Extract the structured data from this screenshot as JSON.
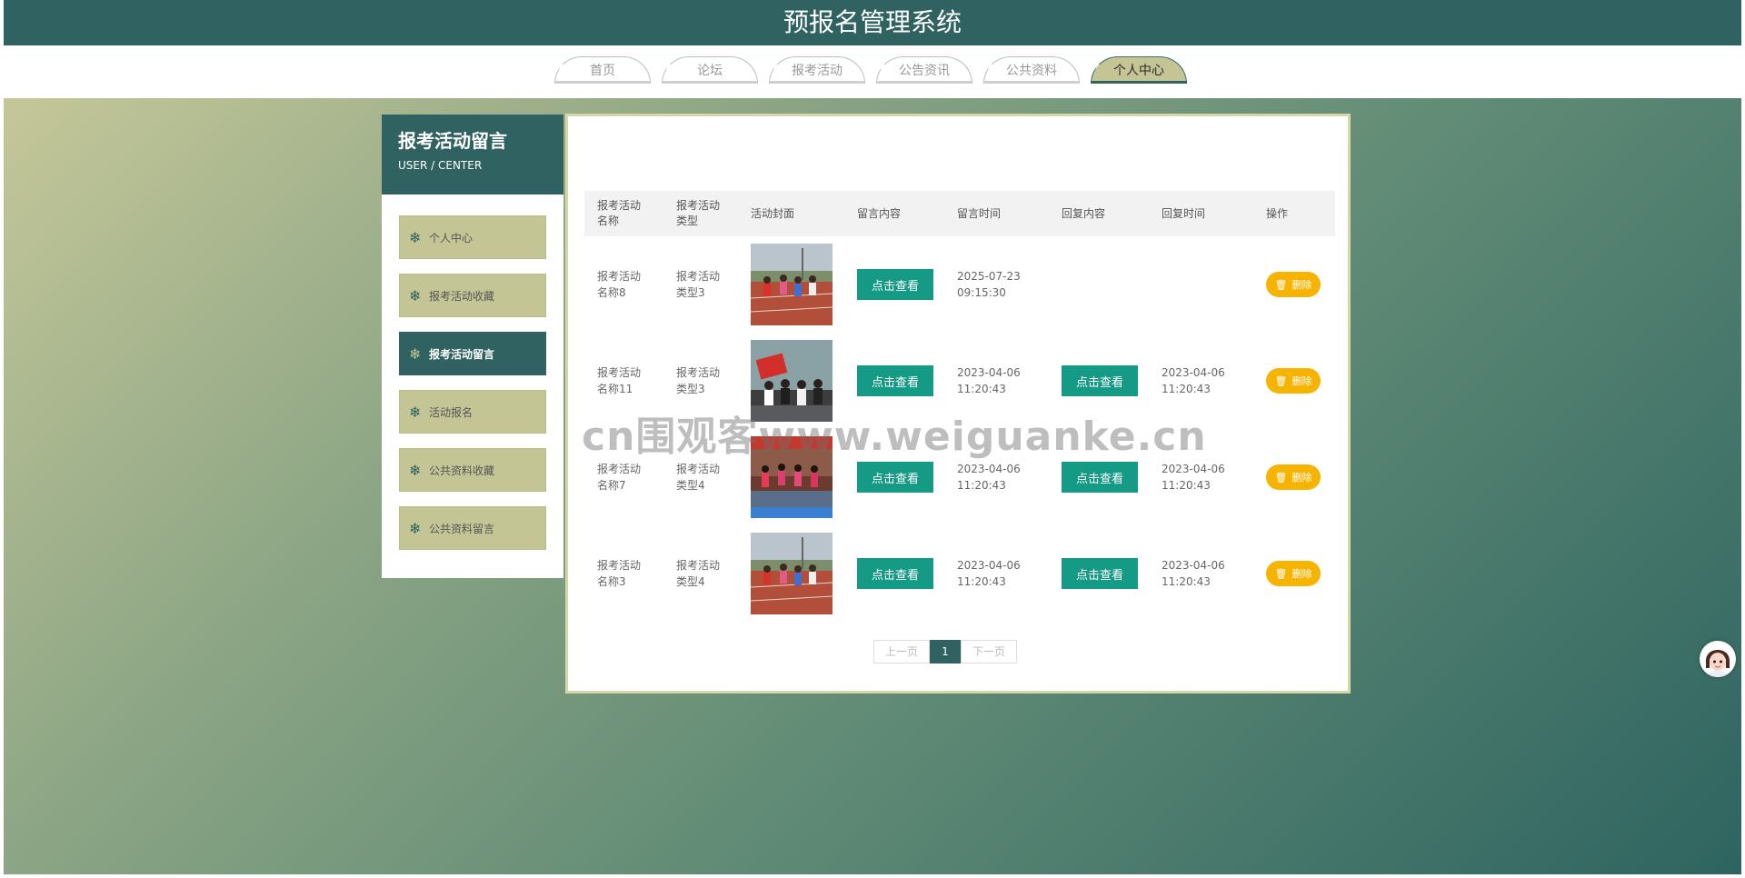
{
  "header": {
    "title": "预报名管理系统"
  },
  "nav": {
    "tabs": [
      {
        "label": "首页"
      },
      {
        "label": "论坛"
      },
      {
        "label": "报考活动"
      },
      {
        "label": "公告资讯"
      },
      {
        "label": "公共资料"
      },
      {
        "label": "个人中心",
        "active": true
      }
    ]
  },
  "sidebar": {
    "title": "报考活动留言",
    "subtitle": "USER / CENTER",
    "items": [
      {
        "label": "个人中心"
      },
      {
        "label": "报考活动收藏"
      },
      {
        "label": "报考活动留言",
        "active": true
      },
      {
        "label": "活动报名"
      },
      {
        "label": "公共资料收藏"
      },
      {
        "label": "公共资料留言"
      }
    ]
  },
  "table": {
    "headers": {
      "name_line1": "报考活动",
      "name_line2": "名称",
      "type_line1": "报考活动",
      "type_line2": "类型",
      "cover": "活动封面",
      "message": "留言内容",
      "message_time": "留言时间",
      "reply": "回复内容",
      "reply_time": "回复时间",
      "actions": "操作"
    },
    "view_label": "点击查看",
    "delete_label": "删除",
    "rows": [
      {
        "name_line1": "报考活动",
        "name_line2": "名称8",
        "type_line1": "报考活动",
        "type_line2": "类型3",
        "time_date": "2025-07-23",
        "time_clock": "09:15:30",
        "reply_date": "",
        "reply_clock": "",
        "cover": "track"
      },
      {
        "name_line1": "报考活动",
        "name_line2": "名称11",
        "type_line1": "报考活动",
        "type_line2": "类型3",
        "time_date": "2023-04-06",
        "time_clock": "11:20:43",
        "reply_date": "2023-04-06",
        "reply_clock": "11:20:43",
        "cover": "group"
      },
      {
        "name_line1": "报考活动",
        "name_line2": "名称7",
        "type_line1": "报考活动",
        "type_line2": "类型4",
        "time_date": "2023-04-06",
        "time_clock": "11:20:43",
        "reply_date": "2023-04-06",
        "reply_clock": "11:20:43",
        "cover": "dance"
      },
      {
        "name_line1": "报考活动",
        "name_line2": "名称3",
        "type_line1": "报考活动",
        "type_line2": "类型4",
        "time_date": "2023-04-06",
        "time_clock": "11:20:43",
        "reply_date": "2023-04-06",
        "reply_clock": "11:20:43",
        "cover": "track"
      }
    ]
  },
  "pager": {
    "prev": "上一页",
    "current": "1",
    "next": "下一页"
  },
  "watermark": {
    "text": "cn围观客www.weiguanke.cn"
  },
  "colors": {
    "primary": "#2f6260",
    "accent": "#159a86",
    "olive": "#c4c595",
    "warning": "#f6b300"
  },
  "icons": {
    "menu": "snowflake-icon",
    "delete": "trash-icon",
    "avatar": "assistant-avatar-icon"
  }
}
